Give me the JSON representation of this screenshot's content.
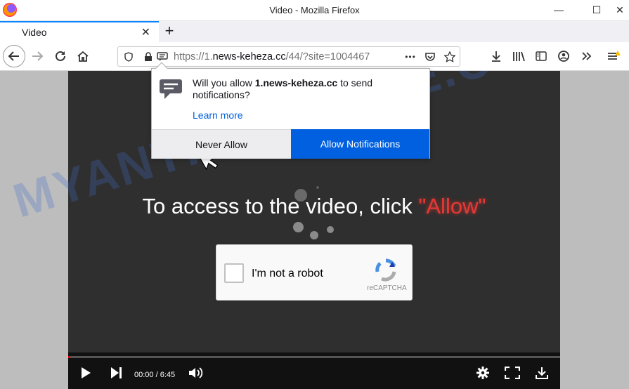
{
  "window": {
    "title": "Video - Mozilla Firefox",
    "minimize": "—",
    "maximize": "☐",
    "close": "✕"
  },
  "tabs": [
    {
      "label": "Video",
      "close": "✕"
    }
  ],
  "new_tab": "+",
  "address_bar": {
    "url_prefix": "https://1.",
    "url_domain": "news-keheza.cc",
    "url_suffix": "/44/?site=1004467",
    "more": "•••"
  },
  "notification": {
    "msg_before": "Will you allow ",
    "msg_domain": "1.news-keheza.cc",
    "msg_after": " to send notifications?",
    "learn_more": "Learn more",
    "never_allow": "Never Allow",
    "allow": "Allow Notifications"
  },
  "page": {
    "headline_text": "To access to the video, click ",
    "headline_allow": "\"Allow\"",
    "watermark": "MYANTISPYWARE.COM"
  },
  "captcha": {
    "label": "I'm not a robot",
    "brand": "reCAPTCHA"
  },
  "player": {
    "time": "00:00 / 6:45",
    "progress": 0.004
  },
  "colors": {
    "accent": "#0060df",
    "allow_text": "#e53935",
    "player_bg": "#2f2f2f"
  }
}
